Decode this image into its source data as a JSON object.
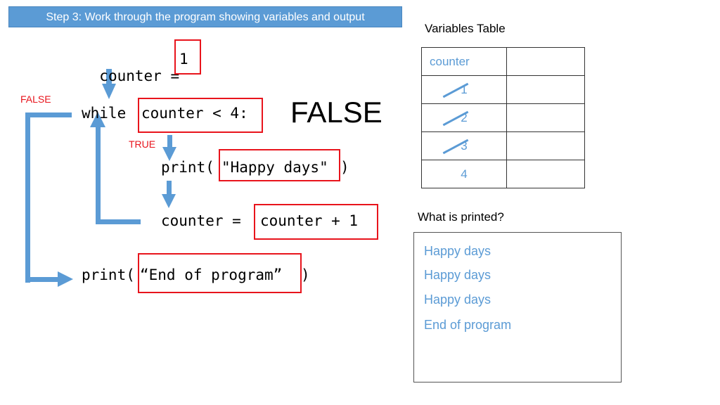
{
  "banner": {
    "title": "Step 3: Work through the program showing variables and output"
  },
  "code": {
    "line1": {
      "text": "counter = ",
      "boxed": "1"
    },
    "line2": {
      "keyword": "while ",
      "boxed": "counter < 4:"
    },
    "line3": {
      "text": "print(",
      "boxed": "\"Happy days\"",
      "close": ")"
    },
    "line4": {
      "text": "counter = ",
      "boxed": "counter + 1"
    },
    "line5": {
      "text": "print(",
      "boxed": "“End of program”",
      "close": ")"
    }
  },
  "labels": {
    "false_branch": "FALSE",
    "true_branch": "TRUE",
    "condition_result": "FALSE"
  },
  "variables_table": {
    "title": "Variables Table",
    "header": [
      "counter",
      ""
    ],
    "rows": [
      {
        "value": "1",
        "crossed_out": true
      },
      {
        "value": "2",
        "crossed_out": true
      },
      {
        "value": "3",
        "crossed_out": true
      },
      {
        "value": "4",
        "crossed_out": false
      }
    ]
  },
  "output": {
    "title": "What is printed?",
    "lines": [
      "Happy days",
      "Happy days",
      "Happy days",
      "End of program"
    ]
  },
  "colors": {
    "accent_blue": "#5b9bd5",
    "highlight_red": "#e8141c"
  }
}
